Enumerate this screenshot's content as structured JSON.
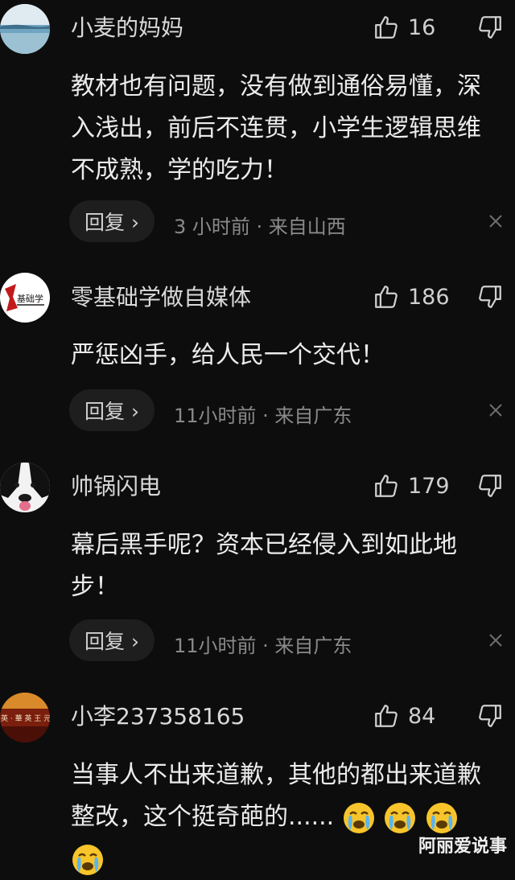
{
  "comments": [
    {
      "user": "小麦的妈妈",
      "likes": "16",
      "text": "教材也有问题，没有做到通俗易懂，深入浅出，前后不连贯，小学生逻辑思维不成熟，学的吃力！",
      "reply": "回复 ›",
      "meta": "3 小时前 · 来自山西",
      "avatar": "beach-avatar"
    },
    {
      "user": "零基础学做自媒体",
      "likes": "186",
      "text": "严惩凶手，给人民一个交代！",
      "reply": "回复 ›",
      "meta": "11小时前 · 来自广东",
      "avatar": "logo-avatar",
      "avatar_text": "基础学"
    },
    {
      "user": "帅锅闪电",
      "likes": "179",
      "text": "幕后黑手呢？资本已经侵入到如此地步！",
      "reply": "回复 ›",
      "meta": "11小时前 · 来自广东",
      "avatar": "dog-avatar"
    },
    {
      "user": "小李237358165",
      "likes": "84",
      "text": "当事人不出来道歉，其他的都出来道歉整改，这个挺奇葩的......",
      "avatar": "restaurant-avatar",
      "avatar_text": "英 · 華 英 王 元"
    }
  ],
  "watermark": "阿丽爱说事",
  "colors": {
    "background": "#0d0d0d",
    "meta": "#8a8a8a",
    "emoji": "#f7c52b"
  }
}
